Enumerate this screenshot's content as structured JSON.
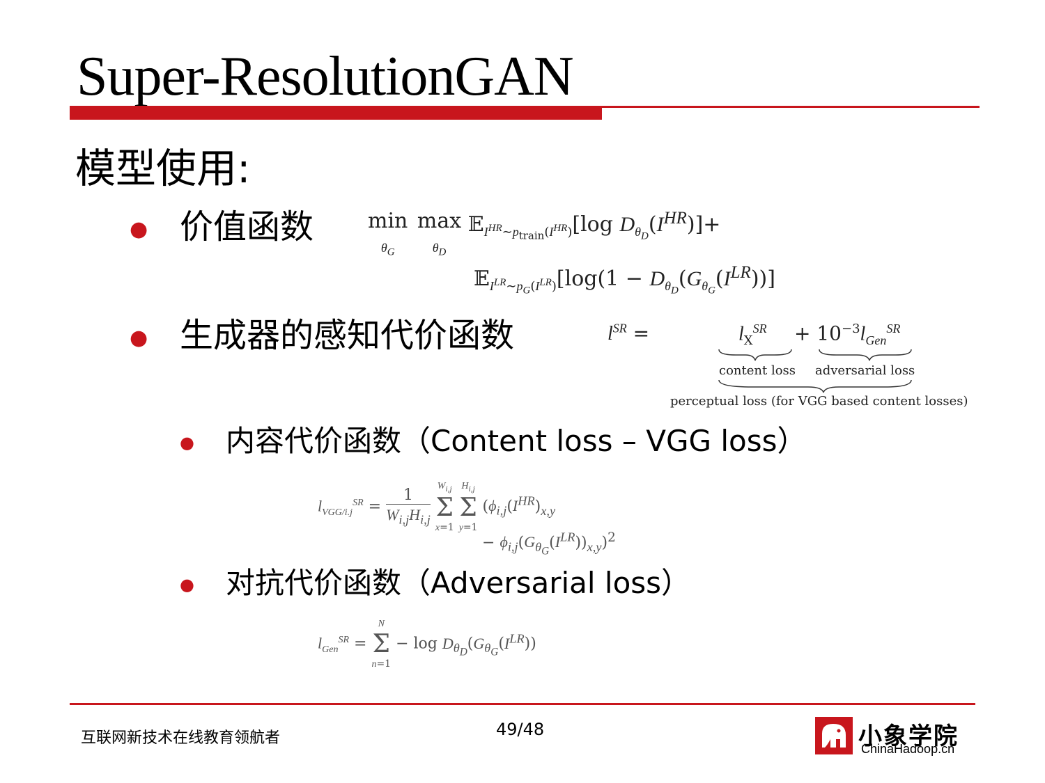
{
  "slide": {
    "title": "Super-ResolutionGAN",
    "heading": "模型使用:",
    "bullets": {
      "value_function": "价值函数",
      "perceptual_cost": "生成器的感知代价函数",
      "content_loss": "内容代价函数（Content loss – VGG loss）",
      "adversarial_loss": "对抗代价函数（Adversarial loss）"
    },
    "formulas": {
      "perceptual_labels": {
        "content_loss": "content loss",
        "adversarial_loss": "adversarial loss",
        "perceptual_loss": "perceptual loss (for VGG based content losses)"
      }
    }
  },
  "footer": {
    "slogan": "互联网新技术在线教育领航者",
    "page": "49/48",
    "logo_cn": "小象学院",
    "logo_en": "ChinaHadoop.cn"
  },
  "colors": {
    "accent": "#c8161d"
  }
}
